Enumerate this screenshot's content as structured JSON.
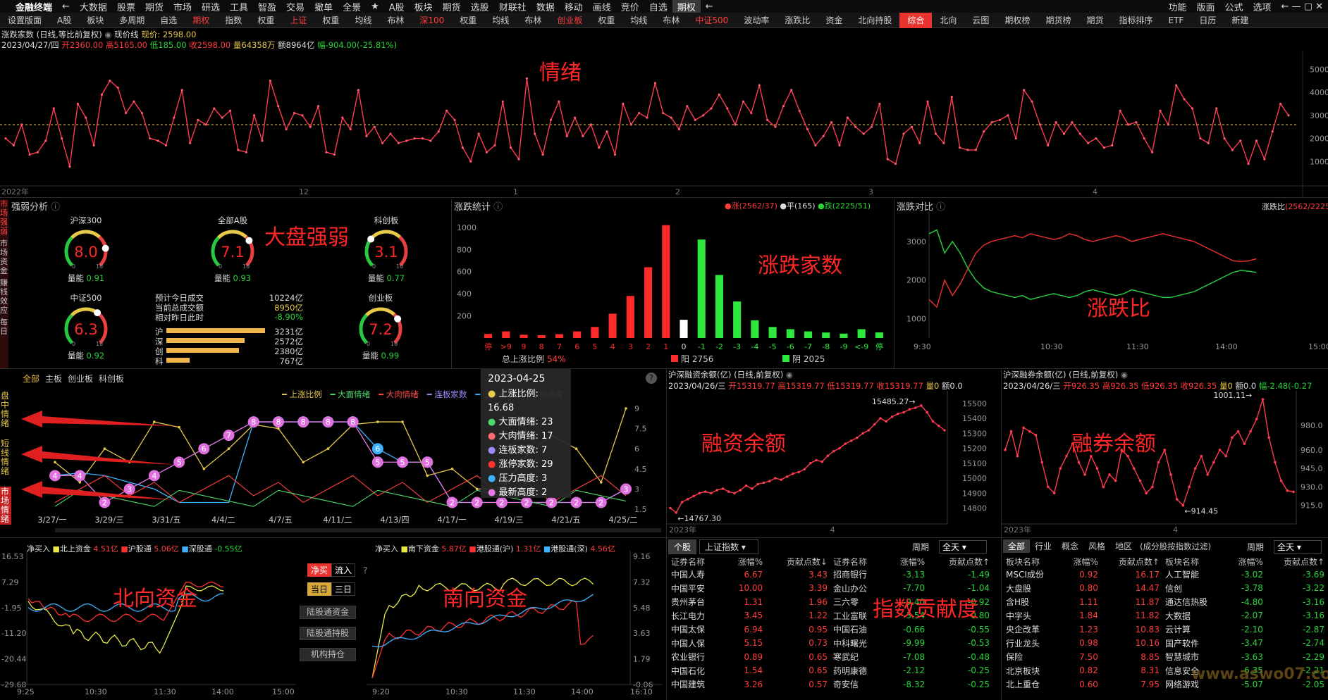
{
  "menubar": {
    "app": "金融终端",
    "items": [
      "←",
      "大数据",
      "股票",
      "期货",
      "市场",
      "研选",
      "工具",
      "智盈",
      "交易",
      "撤单",
      "全景",
      "★",
      "A股",
      "板块",
      "期货",
      "选股",
      "财联社",
      "数据",
      "移动",
      "画线",
      "竞价",
      "自选",
      "期权",
      "←"
    ],
    "selected": "期权",
    "right": [
      "功能",
      "版面",
      "公式",
      "选项"
    ]
  },
  "tabbar": {
    "items": [
      "设置版面",
      "A股",
      "板块",
      "多周期",
      "自选",
      "期权",
      "指数",
      "权重",
      "上证",
      "权重",
      "均线",
      "布林",
      "深100",
      "权重",
      "均线",
      "布林",
      "创业板",
      "权重",
      "均线",
      "布林",
      "中证500",
      "波动率",
      "涨跌比",
      "资金",
      "北向持股",
      "综合",
      "北向",
      "云图",
      "期权榜",
      "期货榜",
      "期货",
      "指标排序",
      "ETF",
      "日历",
      "新建"
    ],
    "red": [
      "期权",
      "上证",
      "深100",
      "创业板",
      "中证500"
    ],
    "active": "综合"
  },
  "top_chart": {
    "title": "涨跌家数 (日线,等比前复权)",
    "price_label": "现价线",
    "price": "现价: 2598.00",
    "date": "2023/04/27/四",
    "open": "开2360.00",
    "high": "高5165.00",
    "low": "低185.00",
    "close": "收2598.00",
    "volume": "量64358万",
    "amount": "额8964亿",
    "change": "幅-904.00(-25.81%)",
    "annotation": "情绪",
    "y_ticks": [
      "5000",
      "4000",
      "3000",
      "2000",
      "1000"
    ],
    "x_ticks": [
      "2022年",
      "12",
      "1",
      "2",
      "3",
      "4"
    ],
    "values": [
      2000,
      1700,
      2600,
      1300,
      1400,
      1900,
      3300,
      2000,
      780,
      3500,
      2900,
      1700,
      3900,
      4500,
      4200,
      3100,
      3600,
      3100,
      2000,
      1900,
      1700,
      2900,
      4100,
      1800,
      2800,
      2600,
      3300,
      2900,
      3200,
      1500,
      1400,
      3000,
      1900,
      4500,
      3400,
      2400,
      3100,
      3000,
      2500,
      3400,
      1400,
      1300,
      2900,
      2400,
      4100,
      2100,
      2500,
      1800,
      2200,
      1800,
      1900,
      2000,
      2000,
      1900,
      2300,
      3200,
      2800,
      1600,
      1000,
      2200,
      1400,
      1700,
      3600,
      1600,
      1100,
      4600,
      2200,
      1300,
      2800,
      3600,
      2100,
      2900,
      2100,
      2600,
      1600,
      2300,
      1300,
      3500,
      2600,
      3100,
      2900,
      4400,
      3100,
      2900,
      2400,
      3400,
      2800,
      3000,
      3300,
      3900,
      3300,
      2600,
      3600,
      3100,
      4300,
      2800,
      2500,
      3400,
      4100,
      3200,
      2400,
      1700,
      2100,
      2700,
      1700,
      2900,
      2500,
      2200,
      2500,
      3500,
      1100,
      900,
      2200,
      2500,
      1800,
      3600,
      2200,
      1800,
      3800,
      1600,
      1500,
      1500,
      2300,
      2700,
      2800,
      3000,
      2000,
      4100,
      3600,
      2600,
      1700,
      2700,
      2200,
      2700,
      2200,
      1800,
      2000,
      1600,
      1700,
      3200,
      2600,
      2700,
      2000,
      1400,
      3200,
      2600,
      4300,
      3700,
      3300,
      2000,
      1800,
      3300,
      2000,
      1500,
      1900,
      900,
      1900,
      1100,
      2300,
      3500,
      3000
    ]
  },
  "strength": {
    "title": "强弱分析",
    "annotation": "大盘强弱",
    "gauges": [
      {
        "name": "沪深300",
        "score": "8.0",
        "vol_label": "量能",
        "vol": "0.91",
        "pct": 0.8
      },
      {
        "name": "全部A股",
        "score": "7.1",
        "vol_label": "量能",
        "vol": "0.93",
        "pct": 0.71
      },
      {
        "name": "科创板",
        "score": "3.1",
        "vol_label": "量能",
        "vol": "0.77",
        "pct": 0.31
      },
      {
        "name": "中证500",
        "score": "6.3",
        "vol_label": "量能",
        "vol": "0.92",
        "pct": 0.63
      },
      {
        "name": "创业板",
        "score": "7.2",
        "vol_label": "量能",
        "vol": "0.99",
        "pct": 0.72
      }
    ],
    "stats": [
      {
        "label": "预计今日成交",
        "value": "10224亿",
        "color": "w"
      },
      {
        "label": "当前总成交额",
        "value": "8950亿",
        "color": "y"
      },
      {
        "label": "相对昨日此时",
        "value": "-8.90%",
        "color": "g"
      }
    ],
    "bars": [
      {
        "label": "沪",
        "value": "3231亿",
        "v": 3231
      },
      {
        "label": "深",
        "value": "2572亿",
        "v": 2572
      },
      {
        "label": "创",
        "value": "2380亿",
        "v": 2380
      },
      {
        "label": "科",
        "value": "767亿",
        "v": 767
      }
    ],
    "side_tabs": [
      "市场强弱",
      "市场资金",
      "赚钱效应",
      "每日"
    ]
  },
  "updown": {
    "title": "涨跌统计",
    "legend": [
      "涨(2562/37)",
      "平(165)",
      "跌(2225/51)"
    ],
    "annotation": "涨跌家数",
    "y_ticks": [
      "1000",
      "800",
      "600",
      "400",
      "200"
    ],
    "cats": [
      "停",
      ">9",
      "9",
      "8",
      "7",
      "6",
      "5",
      "4",
      "3",
      "2",
      "1",
      "0",
      "-1",
      "-2",
      "-3",
      "-4",
      "-5",
      "-6",
      "-7",
      "-8",
      "-9",
      "<-9",
      "停"
    ],
    "values": [
      37,
      60,
      30,
      25,
      35,
      60,
      100,
      220,
      380,
      640,
      1020,
      165,
      890,
      570,
      330,
      160,
      100,
      80,
      60,
      50,
      40,
      80,
      51
    ],
    "ratio_label": "总上涨比例",
    "ratio": "54%",
    "yang": "阳 2756",
    "yin": "阴 2025"
  },
  "ratio": {
    "title": "涨跌对比",
    "label": "涨跌比",
    "ratio": "(2562/2225",
    "annotation": "涨跌比",
    "y_ticks": [
      "3000",
      "2000",
      "1000"
    ],
    "x_ticks": [
      "9:30",
      "10:30",
      "11:30",
      "14:00",
      "15:00"
    ],
    "up": [
      1500,
      1300,
      2000,
      1600,
      1900,
      2300,
      2700,
      2900,
      3000,
      3050,
      3100,
      3150,
      3100,
      3200,
      3150,
      3100,
      3050,
      3100,
      3200,
      3150,
      3050,
      3000,
      3050,
      3100,
      3150,
      3100,
      3000,
      3050,
      3100,
      3150,
      3200,
      3150,
      3100,
      3050,
      3000,
      2900,
      2800,
      2700,
      2600,
      2500,
      2480,
      2500,
      2550
    ],
    "down": [
      3200,
      3300,
      2700,
      3000,
      2700,
      2300,
      2000,
      1800,
      1700,
      1650,
      1600,
      1550,
      1600,
      1500,
      1550,
      1600,
      1650,
      1600,
      1550,
      1600,
      1700,
      1750,
      1700,
      1650,
      1600,
      1650,
      1750,
      1700,
      1650,
      1600,
      1550,
      1550,
      1600,
      1650,
      1700,
      1800,
      1900,
      2000,
      2100,
      2200,
      2250,
      2230,
      2200
    ]
  },
  "sentiment": {
    "tabs": [
      "全部",
      "主板",
      "创业板",
      "科创板"
    ],
    "legend": [
      {
        "name": "上涨比例",
        "color": "#e8c94a"
      },
      {
        "name": "大面情绪",
        "color": "#4cd86a"
      },
      {
        "name": "大肉情绪",
        "color": "#ff4a4a"
      },
      {
        "name": "连板家数",
        "color": "#9a8cff"
      },
      {
        "name": "压力高度",
        "color": "#3fb2ff"
      },
      {
        "name": "最新高度",
        "color": "#e878e8"
      }
    ],
    "tooltip": {
      "date": "2023-04-25",
      "rows": [
        {
          "label": "上涨比例:",
          "value": "16.68",
          "color": "#e8c94a"
        },
        {
          "label": "大面情绪:",
          "value": "23",
          "color": "#4cd86a"
        },
        {
          "label": "大肉情绪:",
          "value": "17",
          "color": "#ff6a6a"
        },
        {
          "label": "连板家数:",
          "value": "7",
          "color": "#9a8cff"
        },
        {
          "label": "涨停家数:",
          "value": "29",
          "color": "#ff3030"
        },
        {
          "label": "压力高度:",
          "value": "3",
          "color": "#3fb2ff"
        },
        {
          "label": "最新高度:",
          "value": "2",
          "color": "#e878e8"
        }
      ]
    },
    "y_ticks": [
      "9",
      "7.5",
      "6",
      "4.5",
      "3",
      "1.5"
    ],
    "x_ticks": [
      "3/27/一",
      "3/29/三",
      "3/31/五",
      "4/4/二",
      "4/7/五",
      "4/11/二",
      "4/13/四",
      "4/17/一",
      "4/19/三",
      "4/21/五",
      "4/25/二"
    ],
    "side_labels": [
      "盘中情绪",
      "短线情绪",
      "市场情绪"
    ],
    "heights": [
      4,
      4,
      2,
      3,
      4,
      5,
      6,
      7,
      8,
      8,
      8,
      8,
      8,
      5,
      5,
      5,
      2,
      2,
      2,
      2,
      2,
      2,
      2,
      3
    ],
    "pressure": [
      4,
      4.2,
      4,
      3.5,
      3,
      2,
      2,
      2,
      8,
      8,
      8,
      8,
      8,
      6,
      5,
      5,
      2,
      2,
      2,
      2,
      2,
      2,
      2,
      3
    ],
    "upratio": [
      5,
      3.5,
      6,
      5,
      8,
      7.6,
      4.5,
      6,
      7.8,
      7.5,
      5,
      6,
      7.8,
      8,
      8,
      4,
      4.5,
      3,
      3,
      5.5,
      7,
      6,
      3.5,
      9
    ]
  },
  "rz": {
    "title": "沪深融资余额(亿) (日线,前复权)",
    "date": "2023/04/26/三",
    "open": "开15319.77",
    "high": "高15319.77",
    "low": "低15319.77",
    "close": "收15319.77",
    "vol": "量0",
    "amt": "额0.0",
    "chg": "幅--",
    "annotation": "融资余额",
    "max_label": "15485.27",
    "min_label": "14767.30",
    "y_ticks": [
      "15500",
      "15400",
      "15300",
      "15200",
      "15100",
      "15000",
      "14900",
      "14800"
    ],
    "x_ticks": [
      "2023年",
      "4"
    ],
    "values": [
      14800,
      14770,
      14840,
      14860,
      14880,
      14900,
      14910,
      14900,
      14920,
      14930,
      14910,
      14900,
      14920,
      14950,
      14930,
      14960,
      14970,
      14980,
      15000,
      14990,
      15010,
      15030,
      15040,
      15060,
      15100,
      15120,
      15110,
      15150,
      15180,
      15200,
      15230,
      15250,
      15270,
      15300,
      15320,
      15360,
      15400,
      15380,
      15410,
      15430,
      15440,
      15460,
      15470,
      15485,
      15440,
      15380,
      15350,
      15320
    ]
  },
  "rq": {
    "title": "沪深融券余额(亿) (日线,前复权)",
    "date": "2023/04/26/三",
    "open": "开926.35",
    "high": "高926.35",
    "low": "低926.35",
    "close": "收926.35",
    "vol": "量0",
    "amt": "额0.0",
    "chg": "幅-2.48(-0.27",
    "annotation": "融券余额",
    "max_label": "1001.11",
    "min_label": "914.45",
    "y_ticks": [
      "980.0",
      "960.0",
      "945.0",
      "930.0",
      "915.0"
    ],
    "x_ticks": [
      "2023年",
      "4"
    ],
    "values": [
      960,
      975,
      955,
      978,
      975,
      972,
      950,
      930,
      925,
      945,
      955,
      965,
      950,
      940,
      955,
      945,
      930,
      940,
      935,
      960,
      955,
      945,
      935,
      925,
      930,
      950,
      960,
      940,
      920,
      915,
      930,
      945,
      955,
      940,
      950,
      960,
      955,
      970,
      975,
      965,
      975,
      985,
      1001,
      970,
      950,
      935,
      927,
      926
    ]
  },
  "north": {
    "label": "净买入",
    "legend": [
      {
        "name": "北上资金",
        "value": "4.51亿",
        "color": "#e8e84a"
      },
      {
        "name": "沪股通",
        "value": "5.06亿",
        "color": "#ff3030"
      },
      {
        "name": "深股通",
        "value": "-0.55亿",
        "color": "#3fb2ff"
      }
    ],
    "annotation": "北向资金",
    "y_ticks": [
      "16.53",
      "7.29",
      "-1.95",
      "-11.20",
      "-20.44",
      "-29.68"
    ],
    "x_ticks": [
      "9:25",
      "10:30",
      "11:30",
      "14:00",
      "15:00"
    ],
    "btn_flow": [
      "净买",
      "流入"
    ],
    "btn_period": [
      "当日",
      "三日"
    ],
    "buttons": [
      "陆股通资金",
      "陆股通持股",
      "机构持仓"
    ]
  },
  "south": {
    "label": "净买入",
    "legend": [
      {
        "name": "南下资金",
        "value": "5.87亿",
        "color": "#e8e84a"
      },
      {
        "name": "港股通(沪)",
        "value": "1.31亿",
        "color": "#ff3030"
      },
      {
        "name": "港股通(深)",
        "value": "4.56亿",
        "color": "#3fb2ff"
      }
    ],
    "annotation": "南向资金",
    "y_ticks": [
      "9.16",
      "7.32",
      "5.48",
      "3.63",
      "1.79",
      "-0.06"
    ],
    "x_ticks": [
      "9:20",
      "10:30",
      "11:30",
      "14:00",
      "16:10"
    ]
  },
  "contrib": {
    "tabs": [
      "个股",
      "上证指数"
    ],
    "period_label": "周期",
    "period": "全天",
    "annotation": "指数贡献度",
    "cols": [
      "证券名称",
      "涨幅%",
      "贡献点数↓",
      "证券名称",
      "涨幅%",
      "贡献点数↑"
    ],
    "rows": [
      [
        "中国人寿",
        "6.67",
        "3.43",
        "招商银行",
        "-3.13",
        "-1.49"
      ],
      [
        "中国平安",
        "10.00",
        "3.39",
        "金山办公",
        "-7.70",
        "-1.04"
      ],
      [
        "贵州茅台",
        "1.31",
        "1.96",
        "三六零",
        "-9.40",
        "-0.92"
      ],
      [
        "长江电力",
        "3.45",
        "1.22",
        "工业富联",
        "-3.54",
        "-0.80"
      ],
      [
        "中国太保",
        "6.94",
        "0.95",
        "中国石油",
        "-0.66",
        "-0.55"
      ],
      [
        "中国人保",
        "5.15",
        "0.73",
        "中科曙光",
        "-9.99",
        "-0.53"
      ],
      [
        "农业银行",
        "0.89",
        "0.65",
        "寒武纪",
        "-7.08",
        "-0.48"
      ],
      [
        "中国石化",
        "1.54",
        "0.65",
        "药明康德",
        "-2.12",
        "-0.25"
      ],
      [
        "中国建筑",
        "3.26",
        "0.57",
        "奇安信",
        "-8.32",
        "-0.25"
      ]
    ]
  },
  "sector": {
    "tabs": [
      "全部",
      "行业",
      "概念",
      "风格",
      "地区"
    ],
    "note": "(成分股按指数过滤)",
    "period_label": "周期",
    "period": "全天",
    "cols": [
      "板块名称",
      "涨幅%",
      "贡献点数↑",
      "板块名称",
      "涨幅%",
      "贡献点数↑"
    ],
    "rows": [
      [
        "MSCI成份",
        "0.92",
        "16.17",
        "人工智能",
        "-3.02",
        "-3.69"
      ],
      [
        "大盘股",
        "0.80",
        "14.47",
        "信创",
        "-3.78",
        "-3.22"
      ],
      [
        "含H股",
        "1.11",
        "11.87",
        "通达信热股",
        "-4.80",
        "-3.16"
      ],
      [
        "中字头",
        "1.84",
        "11.82",
        "大数据",
        "-2.07",
        "-3.16"
      ],
      [
        "央企改革",
        "1.23",
        "10.83",
        "云计算",
        "-2.10",
        "-2.87"
      ],
      [
        "行业龙头",
        "0.98",
        "10.16",
        "国产软件",
        "-3.47",
        "-2.74"
      ],
      [
        "保险",
        "7.50",
        "8.85",
        "智慧城市",
        "-3.63",
        "-2.29"
      ],
      [
        "北京板块",
        "0.82",
        "8.31",
        "信息安全",
        "-6.35",
        "-2.21"
      ],
      [
        "北上重仓",
        "0.60",
        "7.95",
        "网络游戏",
        "-5.07",
        "-2.05"
      ]
    ]
  },
  "watermark": "www.aswo07.com"
}
